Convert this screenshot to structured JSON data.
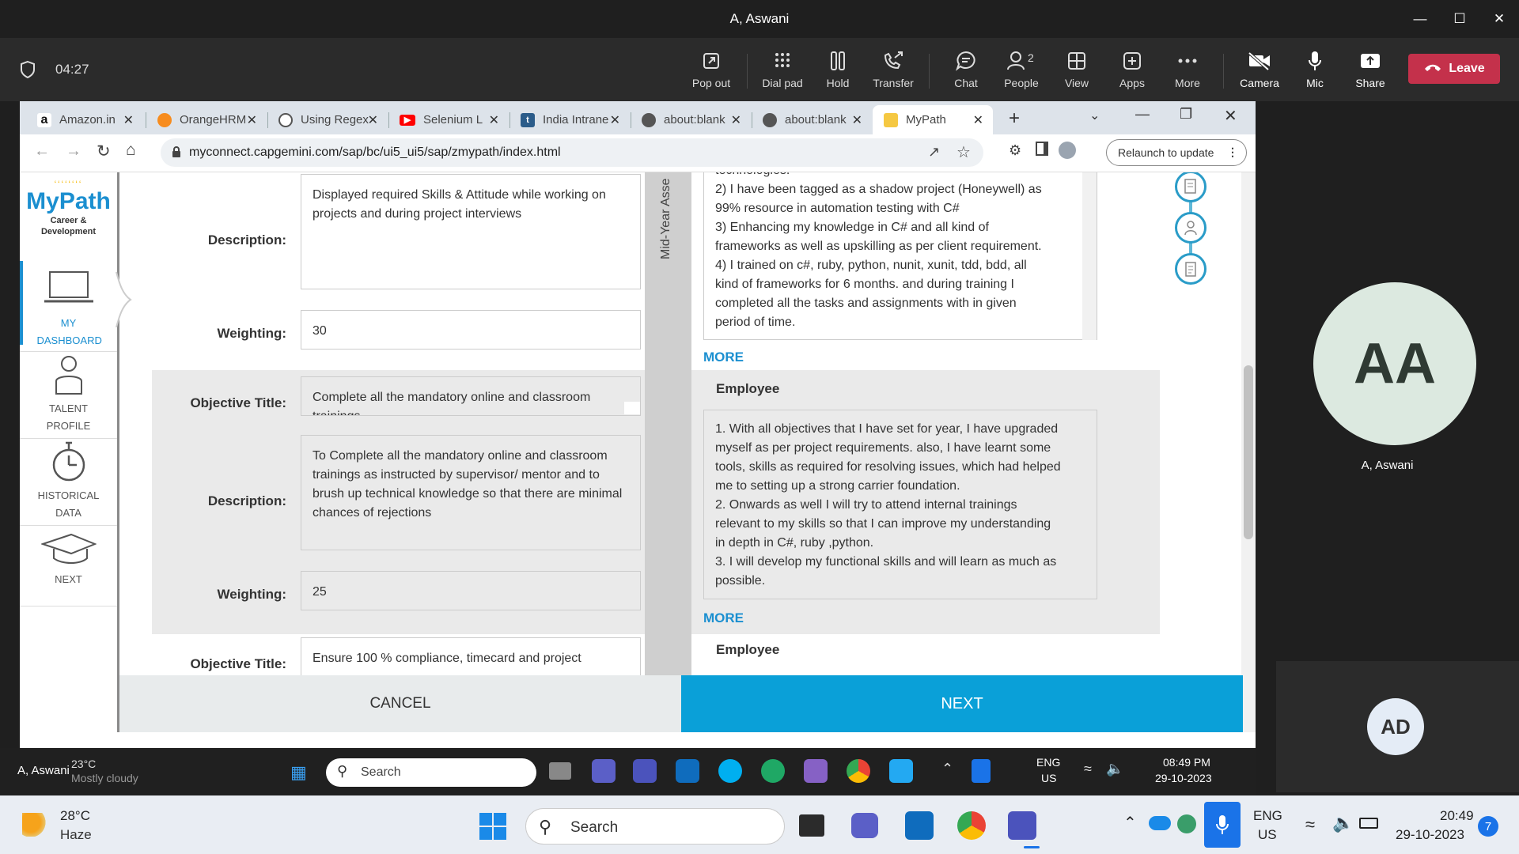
{
  "meeting": {
    "window_title": "A, Aswani",
    "timer": "04:27",
    "toolbar": [
      {
        "label": "Pop out",
        "icon": "popout-icon"
      },
      {
        "label": "Dial pad",
        "icon": "dialpad-icon"
      },
      {
        "label": "Hold",
        "icon": "hold-icon"
      },
      {
        "label": "Transfer",
        "icon": "transfer-icon"
      },
      {
        "label": "Chat",
        "icon": "chat-icon"
      },
      {
        "label": "People",
        "icon": "people-icon",
        "badge": "2"
      },
      {
        "label": "View",
        "icon": "view-icon"
      },
      {
        "label": "Apps",
        "icon": "apps-icon"
      },
      {
        "label": "More",
        "icon": "more-icon"
      },
      {
        "label": "Camera",
        "icon": "camera-off-icon"
      },
      {
        "label": "Mic",
        "icon": "mic-icon"
      },
      {
        "label": "Share",
        "icon": "share-icon"
      }
    ],
    "leave_label": "Leave",
    "participant_initials": "AA",
    "participant_name": "A, Aswani",
    "self_initials": "AD"
  },
  "browser": {
    "tabs": [
      {
        "title": "Amazon.in",
        "icon": "amazon-icon"
      },
      {
        "title": "OrangeHRM",
        "icon": "orangehrm-icon"
      },
      {
        "title": "Using Regex",
        "icon": "chatgpt-icon"
      },
      {
        "title": "Selenium L",
        "icon": "youtube-icon"
      },
      {
        "title": "India Intrane",
        "icon": "tumblr-icon"
      },
      {
        "title": "about:blank",
        "icon": "globe-icon"
      },
      {
        "title": "about:blank",
        "icon": "globe-icon"
      },
      {
        "title": "MyPath",
        "icon": "mypath-icon",
        "active": true
      }
    ],
    "url": "myconnect.capgemini.com/sap/bc/ui5_ui5/sap/zmypath/index.html",
    "relaunch_label": "Relaunch to update"
  },
  "mypath": {
    "logo_title": "MyPath",
    "logo_subtitle": "Career & Development",
    "nav": [
      {
        "label": "MY DASHBOARD",
        "icon": "laptop-icon",
        "active": true
      },
      {
        "label": "TALENT PROFILE",
        "icon": "person-icon"
      },
      {
        "label": "HISTORICAL DATA",
        "icon": "stopwatch-icon"
      },
      {
        "label": "NEXT",
        "icon": "graduation-cap-icon"
      }
    ],
    "vertical_label": "Mid-Year Asse",
    "labels": {
      "description": "Description:",
      "weighting": "Weighting:",
      "objective_title": "Objective Title:"
    },
    "objectives": [
      {
        "description": "Displayed required Skills & Attitude while working on projects and during project interviews",
        "weighting": "30"
      },
      {
        "title": "Complete all the mandatory online and classroom trainings",
        "description": "To Complete all the mandatory online and classroom trainings as instructed by supervisor/ mentor and to brush up technical knowledge so that there are minimal chances of rejections",
        "weighting": "25"
      },
      {
        "title": "Ensure 100 % compliance, timecard and project"
      }
    ],
    "comments": [
      {
        "lines": [
          "technologies.",
          "2) I have been tagged as a shadow project (Honeywell) as",
          "99% resource in automation testing with C#",
          "3) Enhancing my knowledge in C# and all kind of",
          "frameworks as well as upskilling as per client requirement.",
          "4) I trained on c#, ruby, python, nunit, xunit, tdd, bdd, all",
          "kind of frameworks for 6 months. and during training I",
          "completed all the tasks and assignments with in given",
          "period of time."
        ]
      },
      {
        "heading": "Employee",
        "lines": [
          "1. With all objectives that I have set for year, I have upgraded",
          "myself as per project requirements. also, I have learnt some",
          "tools, skills as required for resolving issues, which had helped",
          "me to setting up a strong carrier foundation.",
          "2. Onwards as well I will try to attend internal trainings",
          "relevant to my skills so that I can improve my understanding",
          "in depth in C#, ruby ,python.",
          "3. I will develop my functional skills and will learn as much as",
          "possible."
        ]
      },
      {
        "heading": "Employee"
      }
    ],
    "more_label": "MORE",
    "cancel_label": "CANCEL",
    "next_label": "NEXT"
  },
  "inner_taskbar": {
    "user": "A, Aswani",
    "weather_temp": "23°C",
    "weather_desc": "Mostly cloudy",
    "search_placeholder": "Search",
    "lang": "ENG",
    "region": "US",
    "time": "08:49 PM",
    "date": "29-10-2023"
  },
  "taskbar": {
    "weather_temp": "28°C",
    "weather_desc": "Haze",
    "search_placeholder": "Search",
    "lang": "ENG",
    "region": "US",
    "time": "20:49",
    "date": "29-10-2023",
    "notification_count": "7"
  },
  "colors": {
    "accent": "#0aa0d8",
    "leave": "#c4314b",
    "teams_bg": "#1f1f1f"
  }
}
